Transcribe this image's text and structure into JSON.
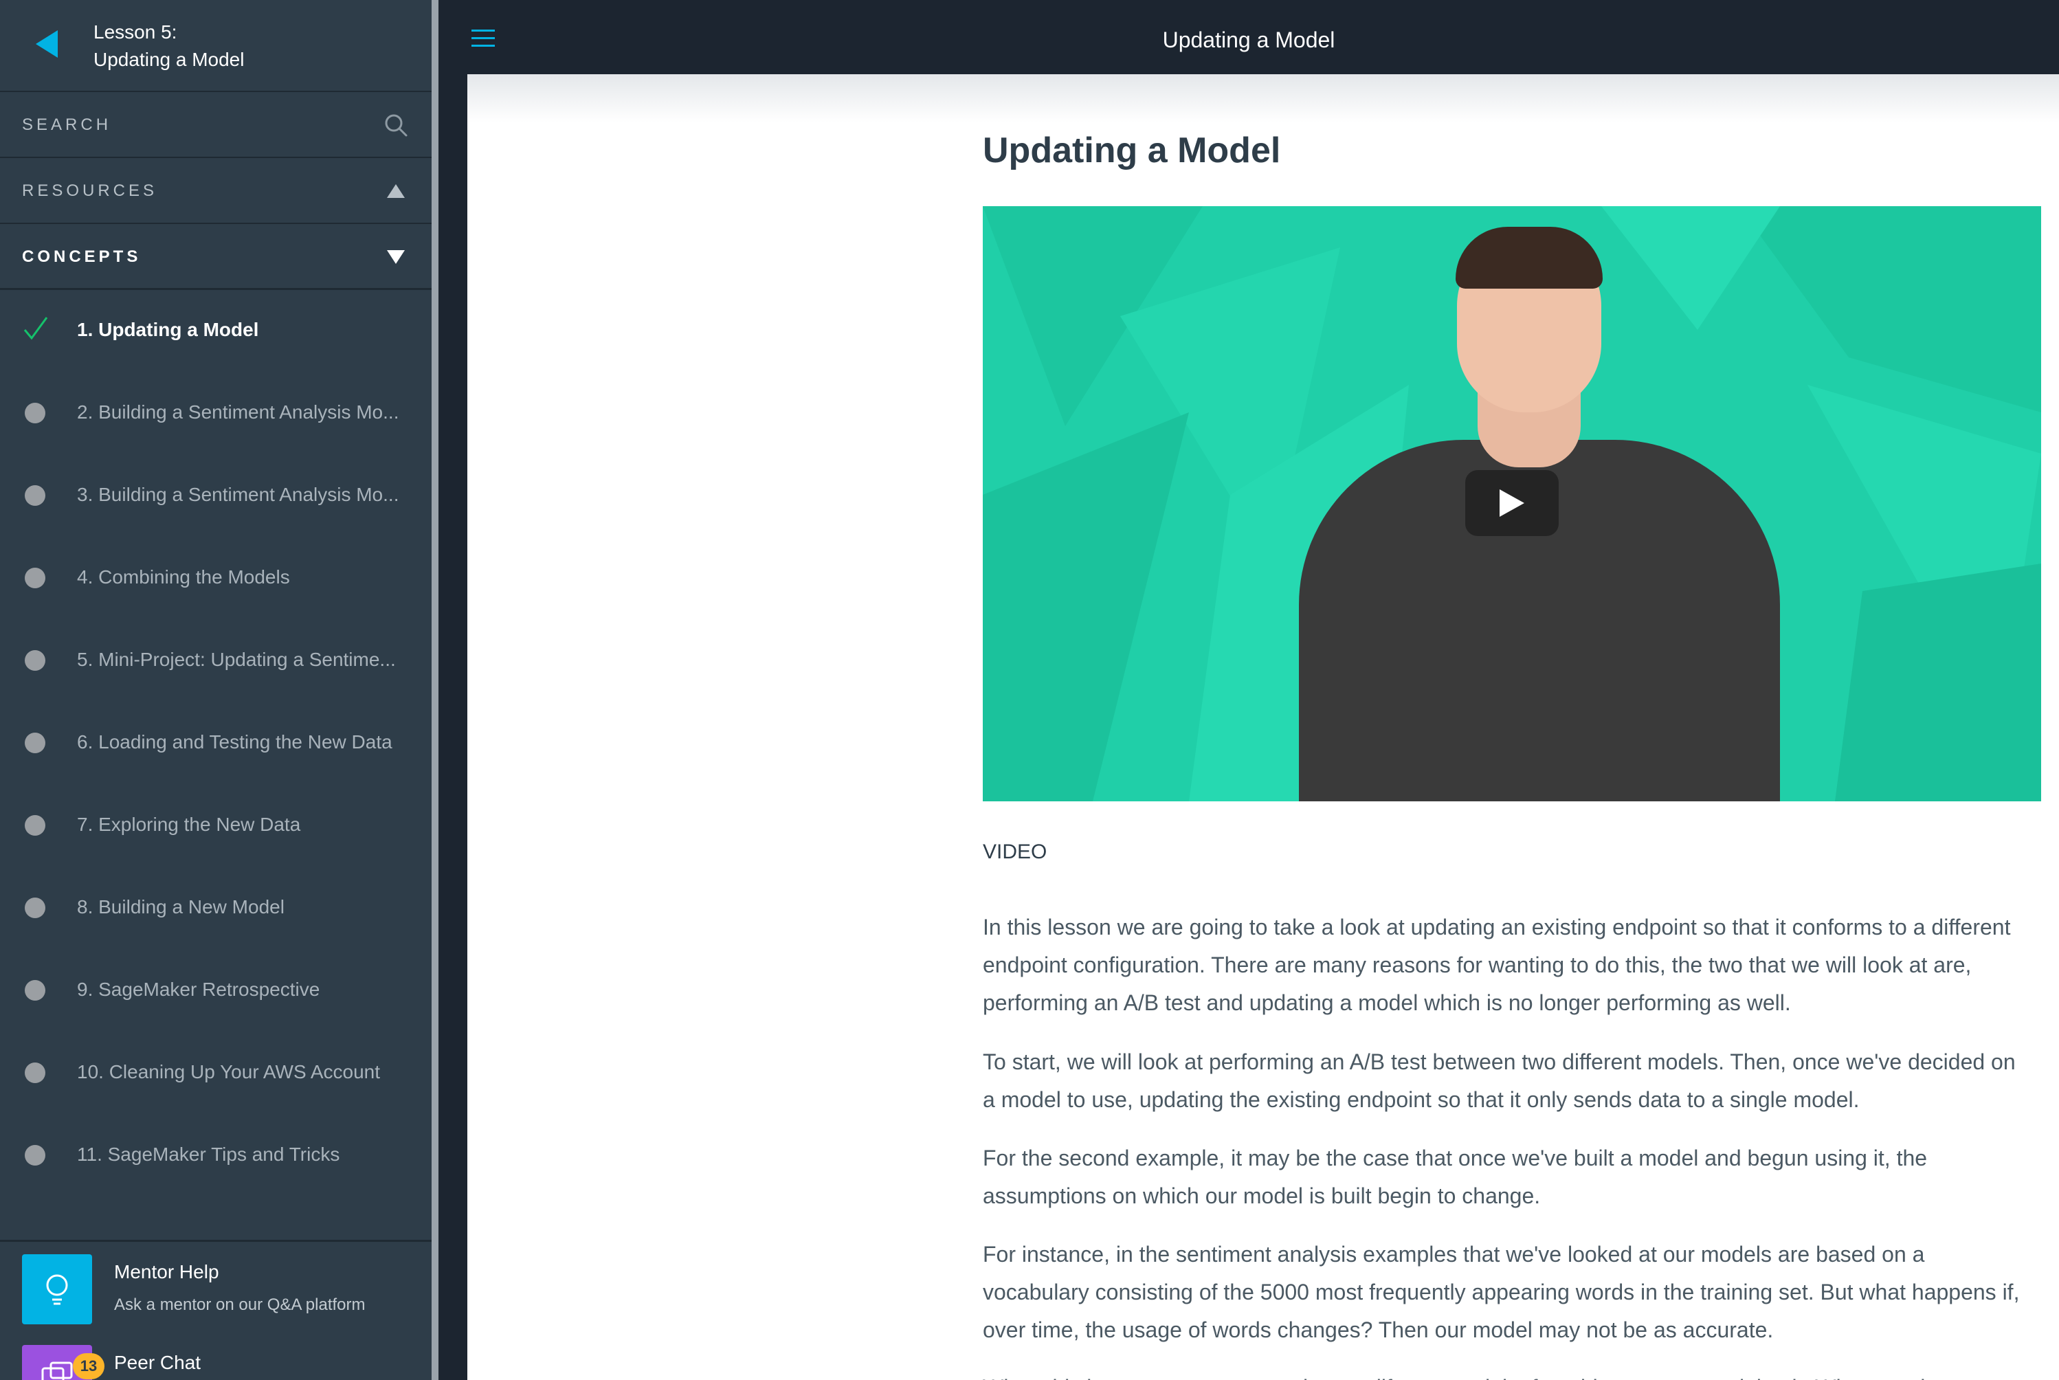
{
  "sidebar": {
    "lesson_label": "Lesson 5:",
    "lesson_title": "Updating a Model",
    "search_label": "SEARCH",
    "resources_label": "RESOURCES",
    "concepts_label": "CONCEPTS",
    "concepts": [
      {
        "label": "1. Updating a Model",
        "status": "completed"
      },
      {
        "label": "2. Building a Sentiment Analysis Mo...",
        "status": "incomplete"
      },
      {
        "label": "3. Building a Sentiment Analysis Mo...",
        "status": "incomplete"
      },
      {
        "label": "4. Combining the Models",
        "status": "incomplete"
      },
      {
        "label": "5. Mini-Project: Updating a Sentime...",
        "status": "incomplete"
      },
      {
        "label": "6. Loading and Testing the New Data",
        "status": "incomplete"
      },
      {
        "label": "7. Exploring the New Data",
        "status": "incomplete"
      },
      {
        "label": "8. Building a New Model",
        "status": "incomplete"
      },
      {
        "label": "9. SageMaker Retrospective",
        "status": "incomplete"
      },
      {
        "label": "10. Cleaning Up Your AWS Account",
        "status": "incomplete"
      },
      {
        "label": "11. SageMaker Tips and Tricks",
        "status": "incomplete"
      }
    ],
    "mentor": {
      "title": "Mentor Help",
      "subtitle": "Ask a mentor on our Q&A platform"
    },
    "peer": {
      "title": "Peer Chat",
      "badge": "13"
    }
  },
  "topbar": {
    "title": "Updating a Model"
  },
  "content": {
    "title": "Updating a Model",
    "video_caption": "VIDEO",
    "paragraphs": [
      "In this lesson we are going to take a look at updating an existing endpoint so that it conforms to a different endpoint configuration. There are many reasons for wanting to do this, the two that we will look at are, performing an A/B test and updating a model which is no longer performing as well.",
      "To start, we will look at performing an A/B test between two different models. Then, once we've decided on a model to use, updating the existing endpoint so that it only sends data to a single model.",
      "For the second example, it may be the case that once we've built a model and begun using it, the assumptions on which our model is built begin to change.",
      "For instance, in the sentiment analysis examples that we've looked at our models are based on a vocabulary consisting of the 5000 most frequently appearing words in the training set. But what happens if, over time, the usage of words changes? Then our model may not be as accurate.",
      "When this happens we may need to modify our model, often this means re-training it. When we do"
    ]
  },
  "colors": {
    "sidebar_bg": "#2e3d49",
    "topbar_bg": "#1c2530",
    "accent": "#02b3e4",
    "check": "#15c26b",
    "video_bg": "#20cfa8",
    "badge": "#fdb52a",
    "peer_tile": "#9b51e0"
  }
}
